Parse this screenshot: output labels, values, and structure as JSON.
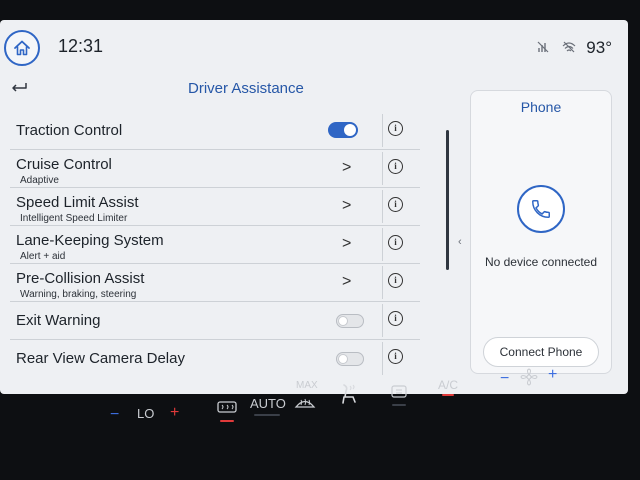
{
  "status_bar": {
    "time": "12:31",
    "temperature": "93°",
    "icons": [
      "home-icon",
      "no-signal-icon",
      "wifi-off-icon"
    ]
  },
  "driver_assistance": {
    "title": "Driver Assistance",
    "back_icon": "back-arrow-icon",
    "rows": [
      {
        "label": "Traction Control",
        "sublabel": "",
        "control": "toggle",
        "state": "on"
      },
      {
        "label": "Cruise Control",
        "sublabel": "Adaptive",
        "control": "chevron"
      },
      {
        "label": "Speed Limit Assist",
        "sublabel": "Intelligent Speed Limiter",
        "control": "chevron"
      },
      {
        "label": "Lane-Keeping System",
        "sublabel": "Alert + aid",
        "control": "chevron"
      },
      {
        "label": "Pre-Collision Assist",
        "sublabel": "Warning, braking, steering",
        "control": "chevron"
      },
      {
        "label": "Exit Warning",
        "sublabel": "",
        "control": "toggle",
        "state": "off"
      },
      {
        "label": "Rear View Camera Delay",
        "sublabel": "",
        "control": "toggle",
        "state": "off"
      }
    ],
    "info_symbol": "i",
    "chevron_symbol": ">"
  },
  "phone_panel": {
    "title": "Phone",
    "status": "No device connected",
    "button": "Connect Phone"
  },
  "climate": {
    "left_temp": "LO",
    "auto": "AUTO",
    "max": "MAX",
    "ac": "A/C",
    "minus": "−",
    "plus": "+"
  },
  "colors": {
    "accent": "#2f66c5",
    "title_blue": "#2657a7",
    "screen_bg": "#eef0f3",
    "bezel": "#0d0f12"
  }
}
